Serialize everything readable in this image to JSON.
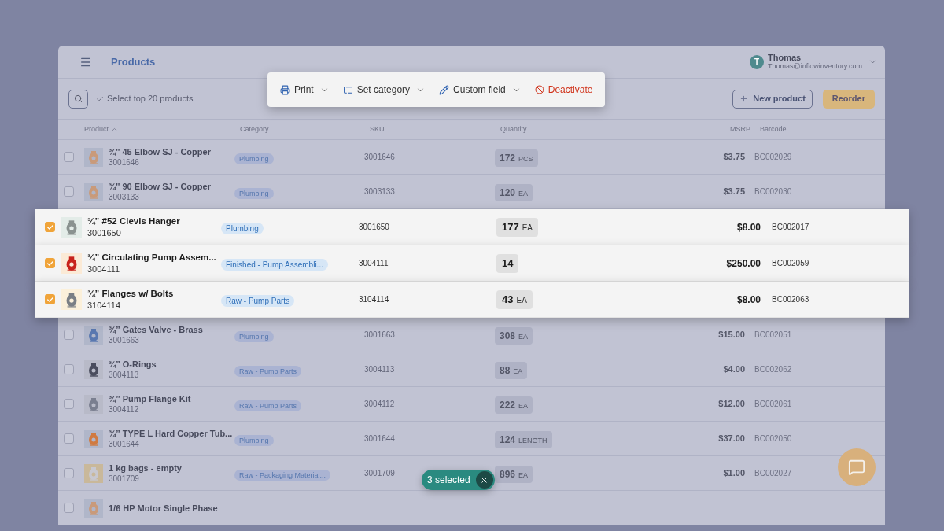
{
  "header": {
    "title": "Products",
    "user": {
      "initial": "T",
      "name": "Thomas",
      "email": "Thomas@inflowinventory.com"
    }
  },
  "toolbar": {
    "select_top": "Select top 20 products",
    "new_button": "New product",
    "reorder_button": "Reorder"
  },
  "bulk_actions": [
    {
      "kind": "print",
      "label": "Print",
      "has_menu": true
    },
    {
      "kind": "category",
      "label": "Set category",
      "has_menu": true
    },
    {
      "kind": "edit",
      "label": "Custom field",
      "has_menu": true
    },
    {
      "kind": "deactivate",
      "label": "Deactivate",
      "has_menu": false
    }
  ],
  "table": {
    "columns": [
      {
        "label": "Product",
        "sorted": true
      },
      {
        "label": "Category",
        "sorted": false
      },
      {
        "label": "SKU",
        "sorted": false
      },
      {
        "label": "Quantity",
        "sorted": false
      },
      {
        "label": "MSRP",
        "sorted": false
      },
      {
        "label": "Barcode",
        "sorted": false
      }
    ],
    "rows": [
      {
        "name": "¾'' 45 Elbow SJ - Copper",
        "code": "3001646",
        "category": "Plumbing",
        "sku": "3001646",
        "quantity": "172",
        "unit": "PCS",
        "msrp": "$3.75",
        "barcode": "BC002029",
        "selected": false
      },
      {
        "name": "¾'' 90 Elbow SJ - Copper",
        "code": "3003133",
        "category": "Plumbing",
        "sku": "3003133",
        "quantity": "120",
        "unit": "EA",
        "msrp": "$3.75",
        "barcode": "BC002030",
        "selected": false
      },
      {
        "name": "¾” #52 Clevis Hanger",
        "code": "3001650",
        "category": "Plumbing",
        "sku": "3001650",
        "quantity": "177",
        "unit": "EA",
        "msrp": "$8.00",
        "barcode": "BC002017",
        "selected": true
      },
      {
        "name": "¾” Circulating Pump Assem...",
        "code": "3004111",
        "category": "Finished - Pump Assembli...",
        "sku": "3004111",
        "quantity": "14",
        "unit": "",
        "msrp": "$250.00",
        "barcode": "BC002059",
        "selected": true
      },
      {
        "name": "¾” Flanges w/ Bolts",
        "code": "3104114",
        "category": "Raw - Pump Parts",
        "sku": "3104114",
        "quantity": "43",
        "unit": "EA",
        "msrp": "$8.00",
        "barcode": "BC002063",
        "selected": true
      },
      {
        "name": "¾” Gates Valve - Brass",
        "code": "3001663",
        "category": "Plumbing",
        "sku": "3001663",
        "quantity": "308",
        "unit": "EA",
        "msrp": "$15.00",
        "barcode": "BC002051",
        "selected": false
      },
      {
        "name": "¾” O-Rings",
        "code": "3004113",
        "category": "Raw - Pump Parts",
        "sku": "3004113",
        "quantity": "88",
        "unit": "EA",
        "msrp": "$4.00",
        "barcode": "BC002062",
        "selected": false
      },
      {
        "name": "¾” Pump Flange Kit",
        "code": "3004112",
        "category": "Raw - Pump Parts",
        "sku": "3004112",
        "quantity": "222",
        "unit": "EA",
        "msrp": "$12.00",
        "barcode": "BC002061",
        "selected": false
      },
      {
        "name": "¾” TYPE L Hard Copper Tub...",
        "code": "3001644",
        "category": "Plumbing",
        "sku": "3001644",
        "quantity": "124",
        "unit": "LENGTH",
        "msrp": "$37.00",
        "barcode": "BC002050",
        "selected": false
      },
      {
        "name": "1 kg bags - empty",
        "code": "3001709",
        "category": "Raw - Packaging Material...",
        "sku": "3001709",
        "quantity": "896",
        "unit": "EA",
        "msrp": "$1.00",
        "barcode": "BC002027",
        "selected": false
      },
      {
        "name": "1/6 HP Motor Single Phase",
        "selected": false
      }
    ]
  },
  "selection": {
    "label": "3 selected"
  }
}
